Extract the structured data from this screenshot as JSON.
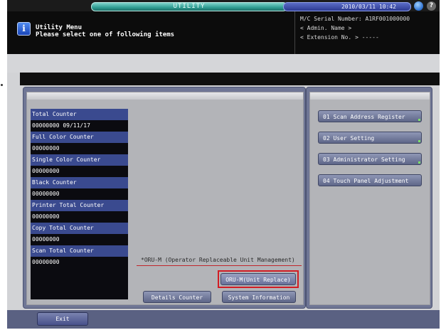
{
  "header": {
    "title": "UTILITY",
    "datetime": "2010/03/11 10:42",
    "help_glyph": "?"
  },
  "message": {
    "line1": "Utility Menu",
    "line2": "Please select one of following items"
  },
  "machine_info": {
    "serial": "M/C Serial Number: A1RF001000000",
    "admin": "< Admin. Name >",
    "extension": "< Extension No. >  -----"
  },
  "counters": [
    {
      "label": "Total Counter",
      "value": "00000000   09/11/17"
    },
    {
      "label": "Full Color Counter",
      "value": "00000000"
    },
    {
      "label": "Single Color Counter",
      "value": "00000000"
    },
    {
      "label": "Black Counter",
      "value": "00000000"
    },
    {
      "label": "Printer Total Counter",
      "value": "00000000"
    },
    {
      "label": "Copy Total Counter",
      "value": "00000000"
    },
    {
      "label": "Scan Total Counter",
      "value": "00000000"
    }
  ],
  "oru_note": "*ORU-M (Operator Replaceable Unit Management)",
  "buttons": {
    "oru_replace": "ORU-M(Unit Replace)",
    "details_counter": "Details Counter",
    "system_information": "System Information"
  },
  "menu_items": [
    "01 Scan Address Register",
    "02 User Setting",
    "03 Administrator Setting",
    "04 Touch Panel Adjustment"
  ],
  "footer": {
    "exit_label": "Exit"
  },
  "colors": {
    "accent_teal": "#2f9c92",
    "panel_blue": "#6f7695",
    "highlight_red": "#d21c24"
  }
}
